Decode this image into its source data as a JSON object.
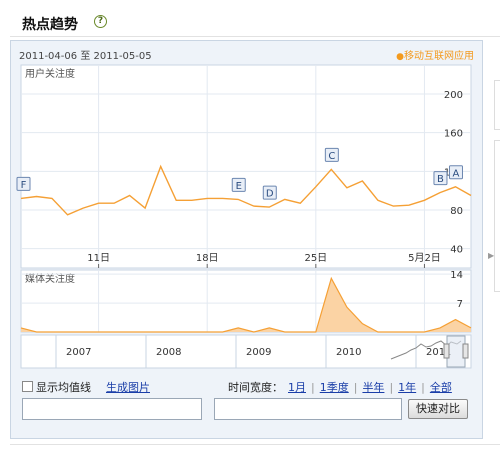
{
  "header": {
    "title": "热点趋势",
    "help_icon": "?"
  },
  "panel": {
    "date_start": "2011-04-06",
    "date_to": "至",
    "date_end": "2011-05-05",
    "legend": "移动互联网应用",
    "legend_color": "#f39a1e"
  },
  "chart_data": [
    {
      "type": "line",
      "title": "用户关注度",
      "y_ticks": [
        40,
        80,
        120,
        160,
        200
      ],
      "ylim": [
        20,
        230
      ],
      "x_labels": [
        "11日",
        "18日",
        "25日",
        "5月2日"
      ],
      "series": [
        {
          "name": "移动互联网应用",
          "color": "#f5a035",
          "values": [
            92,
            94,
            92,
            75,
            82,
            87,
            87,
            95,
            82,
            125,
            90,
            90,
            92,
            92,
            91,
            84,
            83,
            91,
            87,
            104,
            122,
            103,
            110,
            90,
            84,
            85,
            90,
            98,
            104,
            95
          ]
        }
      ],
      "annotations": [
        {
          "label": "A",
          "day": 28
        },
        {
          "label": "B",
          "day": 27
        },
        {
          "label": "C",
          "day": 20
        },
        {
          "label": "D",
          "day": 16
        },
        {
          "label": "E",
          "day": 14
        },
        {
          "label": "F",
          "day": 0
        }
      ]
    },
    {
      "type": "area",
      "title": "媒体关注度",
      "y_ticks": [
        7,
        14
      ],
      "ylim": [
        0,
        15
      ],
      "series": [
        {
          "name": "媒体关注度",
          "color": "#f5a035",
          "values": [
            1,
            0,
            0,
            0,
            0,
            0,
            0,
            0,
            0,
            0,
            0,
            0,
            0,
            0,
            1,
            0,
            1,
            0,
            0,
            0,
            13,
            6,
            2,
            0,
            0,
            0,
            0,
            1,
            3,
            1
          ]
        }
      ]
    }
  ],
  "navigator": {
    "years": [
      "2007",
      "2008",
      "2009",
      "2010",
      "2011"
    ]
  },
  "controls": {
    "show_avg_label": "显示均值线",
    "generate_image": "生成图片",
    "time_width_label": "时间宽度：",
    "ranges": [
      "1月",
      "1季度",
      "半年",
      "1年",
      "全部"
    ],
    "compare_button": "快速对比"
  }
}
